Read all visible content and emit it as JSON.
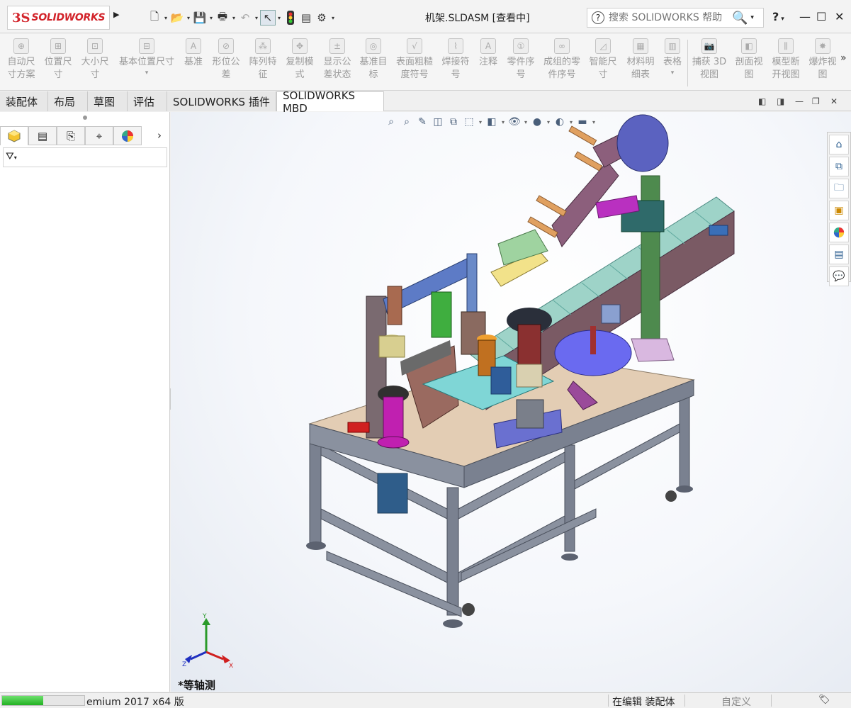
{
  "app": {
    "logo_mark": "3S",
    "logo_text": "SOLIDWORKS",
    "doc_title": "机架.SLDASM [查看中]",
    "search_placeholder": "搜索 SOLIDWORKS 帮助",
    "help_label": "?"
  },
  "quick_access": [
    "new-icon",
    "open-icon",
    "save-icon",
    "print-icon",
    "undo-icon",
    "select-icon",
    "rebuild-icon",
    "file-properties-icon",
    "options-icon"
  ],
  "command_manager": {
    "items": [
      {
        "label": "自动尺\n寸方案",
        "icon": "auto-dimension-scheme-icon"
      },
      {
        "label": "位置尺\n寸",
        "icon": "location-dimension-icon"
      },
      {
        "label": "大小尺\n寸",
        "icon": "size-dimension-icon"
      },
      {
        "label": "基本位置尺寸",
        "icon": "basic-location-dimension-icon"
      },
      {
        "label": "基准",
        "icon": "datum-icon"
      },
      {
        "label": "形位公\n差",
        "icon": "geometric-tolerance-icon"
      },
      {
        "label": "阵列特\n征",
        "icon": "pattern-feature-icon"
      },
      {
        "label": "复制模\n式",
        "icon": "copy-scheme-icon"
      },
      {
        "label": "显示公\n差状态",
        "icon": "show-tolerance-status-icon"
      },
      {
        "label": "基准目\n标",
        "icon": "datum-target-icon"
      },
      {
        "label": "表面粗糙\n度符号",
        "icon": "surface-finish-icon"
      },
      {
        "label": "焊接符\n号",
        "icon": "weld-symbol-icon"
      },
      {
        "label": "注释",
        "icon": "note-icon"
      },
      {
        "label": "零件序\n号",
        "icon": "balloon-icon"
      },
      {
        "label": "成组的零\n件序号",
        "icon": "stacked-balloon-icon"
      },
      {
        "label": "智能尺\n寸",
        "icon": "smart-dimension-icon"
      },
      {
        "label": "材料明\n细表",
        "icon": "bom-icon"
      },
      {
        "label": "表格",
        "icon": "table-icon"
      },
      {
        "label": "捕获 3D\n视图",
        "icon": "capture-3d-view-icon"
      },
      {
        "label": "剖面视\n图",
        "icon": "section-view-icon"
      },
      {
        "label": "模型断\n开视图",
        "icon": "model-break-view-icon"
      },
      {
        "label": "爆炸视\n图",
        "icon": "exploded-view-icon"
      }
    ],
    "more": "»"
  },
  "tabs": [
    {
      "label": "装配体",
      "active": false
    },
    {
      "label": "布局",
      "active": false
    },
    {
      "label": "草图",
      "active": false
    },
    {
      "label": "评估",
      "active": false
    },
    {
      "label": "SOLIDWORKS 插件",
      "active": false
    },
    {
      "label": "SOLIDWORKS MBD",
      "active": true
    }
  ],
  "left_panel": {
    "tabs": [
      "feature-manager-icon",
      "property-manager-icon",
      "configuration-manager-icon",
      "dimxpert-icon",
      "display-manager-icon"
    ],
    "filter_icon": "filter-icon"
  },
  "viewport": {
    "view_name": "*等轴测",
    "triad": {
      "x": "X",
      "y": "Y",
      "z": "Z"
    },
    "task_pane": [
      "home-icon",
      "design-library-icon",
      "file-explorer-icon",
      "view-palette-icon",
      "appearances-icon",
      "custom-properties-icon",
      "forum-icon"
    ]
  },
  "status_bar": {
    "progress_percent": 50,
    "version": "emium 2017 x64 版",
    "mode": "在编辑 装配体",
    "custom": "自定义"
  },
  "colors": {
    "brand_red": "#d2232a",
    "frame_gray": "#6f7684",
    "table_top": "#e3cdb4",
    "conveyor": "#9ed3c8"
  }
}
